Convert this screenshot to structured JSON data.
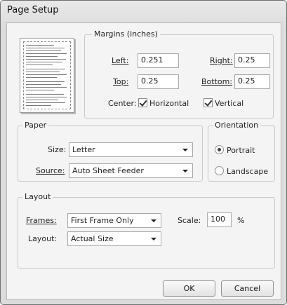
{
  "window": {
    "title": "Page Setup"
  },
  "margins": {
    "group_label": "Margins (inches)",
    "left_label": "Left:",
    "left_value": "0.251",
    "right_label": "Right:",
    "right_value": "0.25",
    "top_label": "Top:",
    "top_value": "0.25",
    "bottom_label": "Bottom:",
    "bottom_value": "0.25",
    "center_label": "Center:",
    "horizontal_label": "Horizontal",
    "horizontal_checked": true,
    "vertical_label": "Vertical",
    "vertical_checked": true
  },
  "paper": {
    "group_label": "Paper",
    "size_label": "Size:",
    "size_value": "Letter",
    "source_label": "Source:",
    "source_value": "Auto Sheet Feeder"
  },
  "orientation": {
    "group_label": "Orientation",
    "portrait_label": "Portrait",
    "portrait_selected": true,
    "landscape_label": "Landscape",
    "landscape_selected": false
  },
  "layout": {
    "group_label": "Layout",
    "frames_label": "Frames:",
    "frames_value": "First Frame Only",
    "scale_label": "Scale:",
    "scale_value": "100",
    "scale_unit": "%",
    "layout_label": "Layout:",
    "layout_value": "Actual Size"
  },
  "buttons": {
    "ok": "OK",
    "cancel": "Cancel"
  },
  "icons": {
    "dropdown": "chevron-down-icon",
    "preview": "page-preview-icon"
  }
}
